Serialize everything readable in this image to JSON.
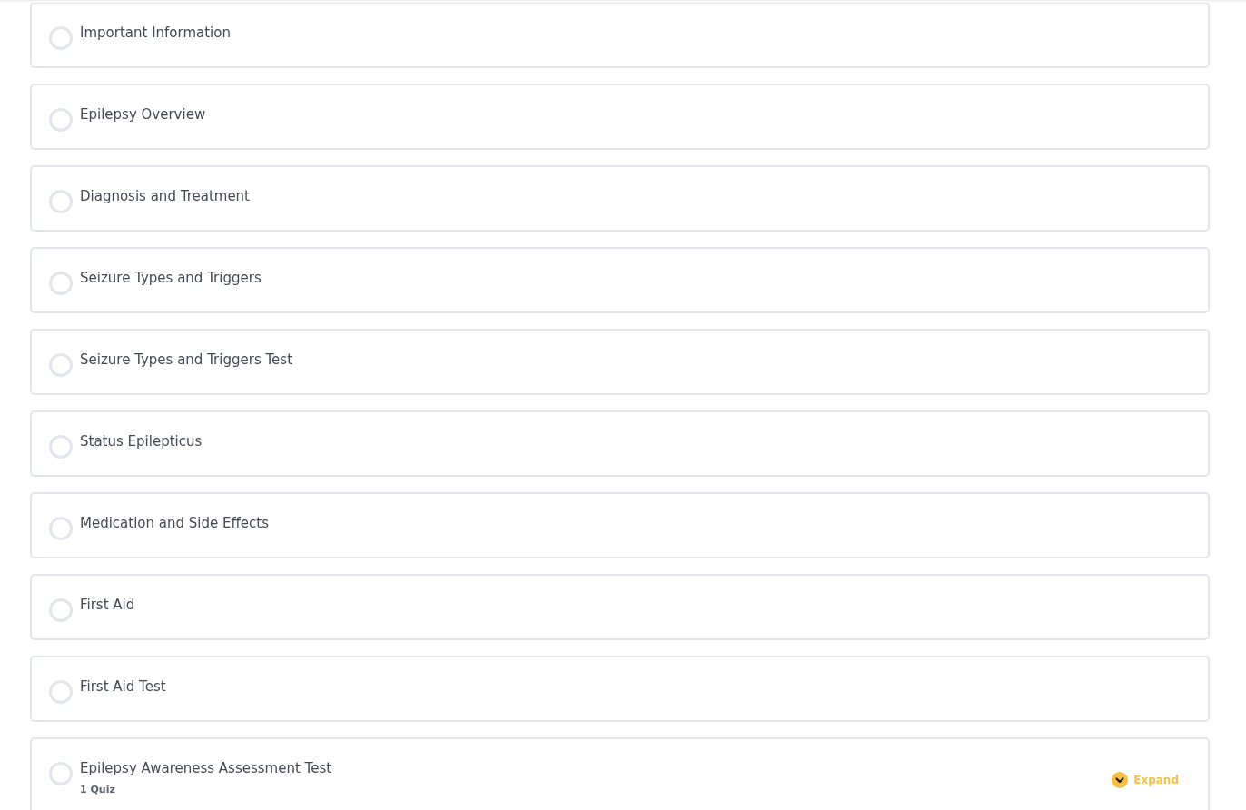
{
  "lessons": [
    {
      "title": "Important Information",
      "completed": false
    },
    {
      "title": "Epilepsy Overview",
      "completed": false
    },
    {
      "title": "Diagnosis and Treatment",
      "completed": false
    },
    {
      "title": "Seizure Types and Triggers",
      "completed": false
    },
    {
      "title": "Seizure Types and Triggers Test",
      "completed": false
    },
    {
      "title": "Status Epilepticus",
      "completed": false
    },
    {
      "title": "Medication and Side Effects",
      "completed": false
    },
    {
      "title": "First Aid",
      "completed": false
    },
    {
      "title": "First Aid Test",
      "completed": false
    },
    {
      "title": "Epilepsy Awareness Assessment Test",
      "completed": false,
      "count": "1 Quiz",
      "expand": {
        "label": "Expand",
        "expanded": false
      }
    }
  ]
}
